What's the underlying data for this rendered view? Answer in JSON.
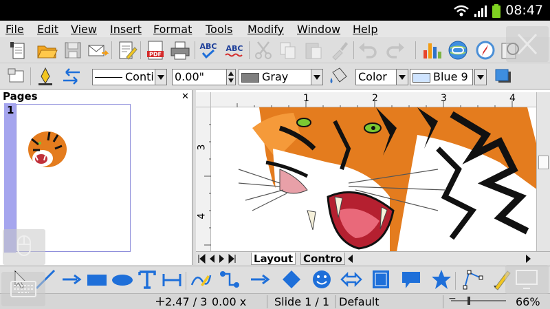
{
  "status_bar": {
    "time": "08:47"
  },
  "menu": [
    "File",
    "Edit",
    "View",
    "Insert",
    "Format",
    "Tools",
    "Modify",
    "Window",
    "Help"
  ],
  "line_props": {
    "line_style": "Conti",
    "line_width": "0.00\"",
    "line_color": "Gray",
    "area_style": "Color",
    "area_color": "Blue 9"
  },
  "pages_panel": {
    "title": "Pages",
    "slide_number": "1"
  },
  "ruler": {
    "h_ticks": [
      "1",
      "2",
      "3",
      "4"
    ],
    "v_ticks": [
      "3",
      "4"
    ]
  },
  "tabs": [
    "Layout",
    "Contro"
  ],
  "status": {
    "position": "2.47 / 3",
    "size": "0.00 x",
    "slide": "Slide 1 / 1",
    "layout": "Default",
    "zoom": "66%"
  },
  "colors": {
    "accent_blue": "#1e6fd9",
    "selection_blue": "#a5a5ee",
    "tiger_orange": "#e47c1e"
  }
}
